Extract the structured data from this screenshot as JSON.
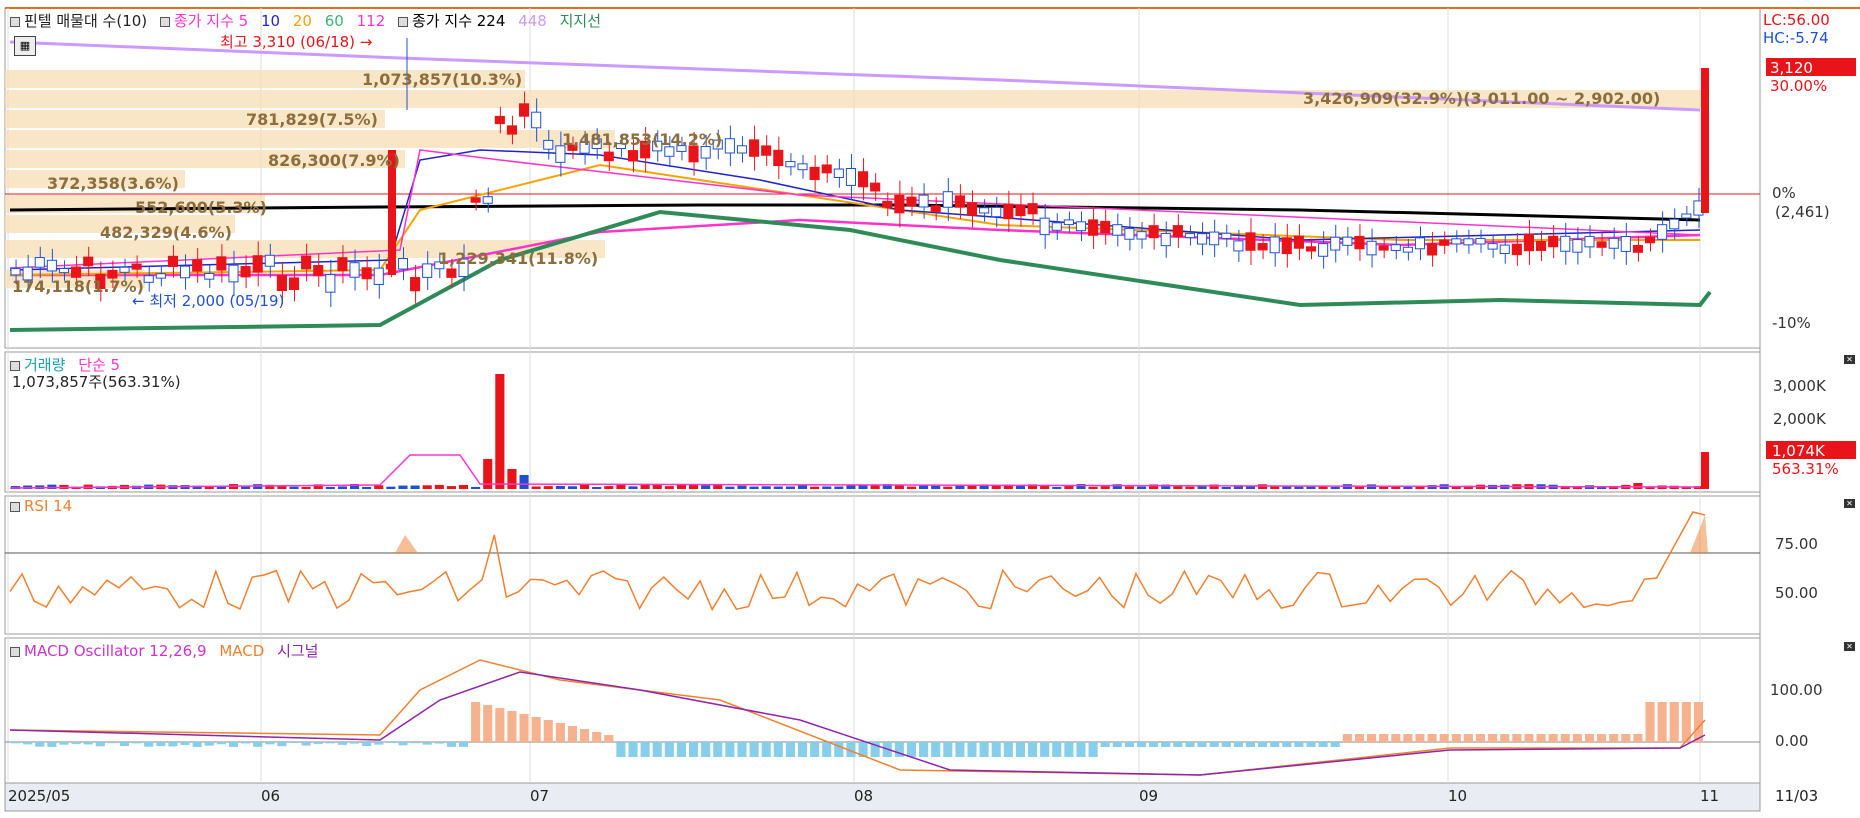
{
  "main_legend": {
    "item1": "핀텔 매물대 수(10)",
    "item2": "종가 지수 5",
    "ma10": "10",
    "ma20": "20",
    "ma60": "60",
    "ma112": "112",
    "item3": "종가 지수 224",
    "ma448": "448",
    "item4": "지지선"
  },
  "right_info": {
    "lc": "LC:56.00",
    "hc": "HC:-5.74",
    "price": "3,120",
    "pct": "30.00%",
    "zero_pct": "0%",
    "zero_val": "(2,461)",
    "minus10": "-10%"
  },
  "annotations": {
    "high": "최고 3,310 (06/18) →",
    "low": "← 최저 2,000 (05/19)"
  },
  "volume_profile": [
    {
      "label": "1,073,857(10.3%)"
    },
    {
      "label": "781,829(7.5%)"
    },
    {
      "label": "826,300(7.9%)"
    },
    {
      "label": "1,481,853(14.2%)"
    },
    {
      "label": "372,358(3.6%)"
    },
    {
      "label": "552,600(5.3%)"
    },
    {
      "label": "482,329(4.6%)"
    },
    {
      "label": "1,229,341(11.8%)"
    },
    {
      "label": "174,118(1.7%)"
    },
    {
      "label": "3,426,909(32.9%)(3,011.00 ~ 2,902.00)"
    }
  ],
  "volume_panel": {
    "title": "거래량",
    "ma": "단순 5",
    "info": "1,073,857주(563.31%)",
    "ticks": [
      "3,000K",
      "2,000K"
    ],
    "last_badge": "1,074K",
    "last_pct": "563.31%"
  },
  "rsi_panel": {
    "title": "RSI 14",
    "ticks": [
      "75.00",
      "50.00"
    ]
  },
  "macd_panel": {
    "title": "MACD Oscillator 12,26,9",
    "macd": "MACD",
    "signal": "시그널",
    "ticks": [
      "100.00",
      "0.00"
    ]
  },
  "x_axis": {
    "labels": [
      "2025/05",
      "06",
      "07",
      "08",
      "09",
      "10",
      "11",
      "11/03"
    ]
  },
  "colors": {
    "up": "#e8141a",
    "down": "#1e50d2",
    "ma5": "#ff33cc",
    "ma10": "#2222cc",
    "ma20": "#f5a300",
    "ma60": "#3cb371",
    "ma112": "#ff33cc",
    "ma224": "#000000",
    "ma448": "#cc99ff",
    "support": "#2e8b57",
    "vp": "#f5deb3",
    "rsi": "#f08030",
    "macd": "#f08030",
    "signal": "#8e24aa"
  }
}
